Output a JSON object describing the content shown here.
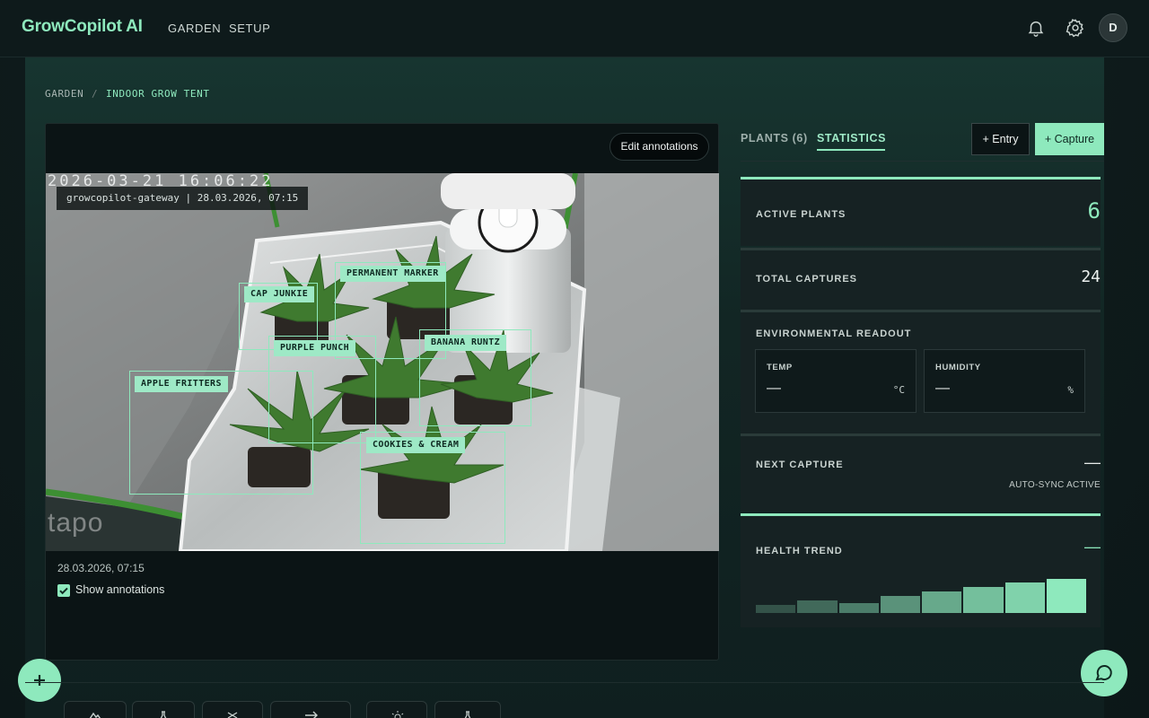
{
  "app": {
    "brand": "GrowCopilot AI",
    "nav": [
      "GARDEN",
      "SETUP"
    ],
    "avatar_initial": "D"
  },
  "icons": {
    "notifications": "bell-icon",
    "settings": "gear-icon",
    "add": "plus-icon",
    "chat": "chat-bubble-icon"
  },
  "breadcrumb": {
    "root": "GARDEN",
    "separator": "/",
    "current": "INDOOR GROW TENT"
  },
  "camera": {
    "edit_label": "Edit annotations",
    "overlay_timestamp": "2026-03-21 16:06:22",
    "gateway_label": "growcopilot-gateway | 28.03.2026, 07:15",
    "watermark": "tapo",
    "capture_date": "28.03.2026, 07:15",
    "show_annotations_label": "Show annotations",
    "show_annotations": true,
    "annotations": [
      "CAP JUNKIE",
      "PERMANENT MARKER",
      "PURPLE PUNCH",
      "BANANA RUNTZ",
      "APPLE FRITTERS",
      "COOKIES & CREAM"
    ]
  },
  "tabs": {
    "plants": "PLANTS (6)",
    "statistics": "STATISTICS",
    "active": "statistics"
  },
  "actions": {
    "entry": "+ Entry",
    "capture": "+ Capture"
  },
  "stats": {
    "active_plants_label": "ACTIVE PLANTS",
    "active_plants_value": "6",
    "total_captures_label": "TOTAL CAPTURES",
    "total_captures_value": "24",
    "env_label": "ENVIRONMENTAL READOUT",
    "temp_label": "TEMP",
    "temp_value": "—",
    "temp_unit": "°C",
    "humidity_label": "HUMIDITY",
    "humidity_value": "—",
    "humidity_unit": "%",
    "next_capture_label": "NEXT CAPTURE",
    "next_capture_value": "—",
    "auto_sync_label": "AUTO-SYNC ACTIVE",
    "health_label": "HEALTH TREND",
    "health_value": "—",
    "health_trend": [
      0.24,
      0.37,
      0.3,
      0.5,
      0.63,
      0.76,
      0.89,
      1.0
    ]
  },
  "colors": {
    "accent": "#8ee9bd",
    "background": "#0f1d1d",
    "panel": "#162223"
  }
}
